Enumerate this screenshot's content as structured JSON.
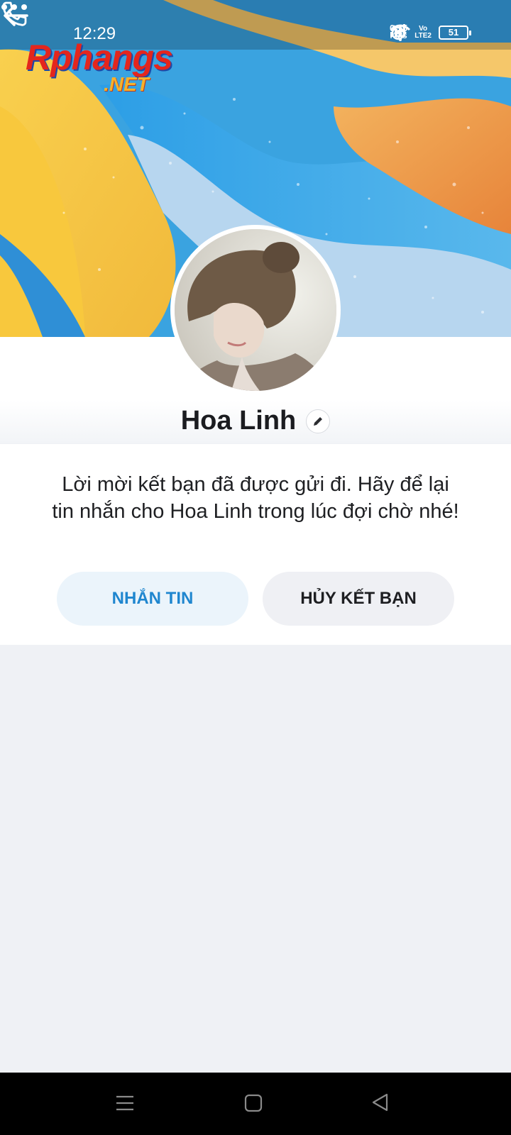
{
  "status_bar": {
    "time": "12:29",
    "speed_value": "0.75",
    "speed_unit": "KB/S",
    "volte_top": "Vo",
    "volte_bottom": "LTE2",
    "battery": "51"
  },
  "watermark": {
    "main": "Rphangs",
    "suffix": ".NET"
  },
  "profile": {
    "name": "Hoa Linh",
    "message": "Lời mời kết bạn đã được gửi đi. Hãy để lại tin nhắn cho Hoa Linh trong lúc đợi chờ nhé!",
    "message_button": "NHẮN TIN",
    "cancel_button": "HỦY KẾT BẠN"
  },
  "colors": {
    "accent": "#1f86cf",
    "page_bg": "#eff1f5"
  },
  "icons": {
    "back": "arrow-left-icon",
    "call": "phone-icon",
    "more": "more-dots-icon",
    "edit": "pencil-icon"
  }
}
